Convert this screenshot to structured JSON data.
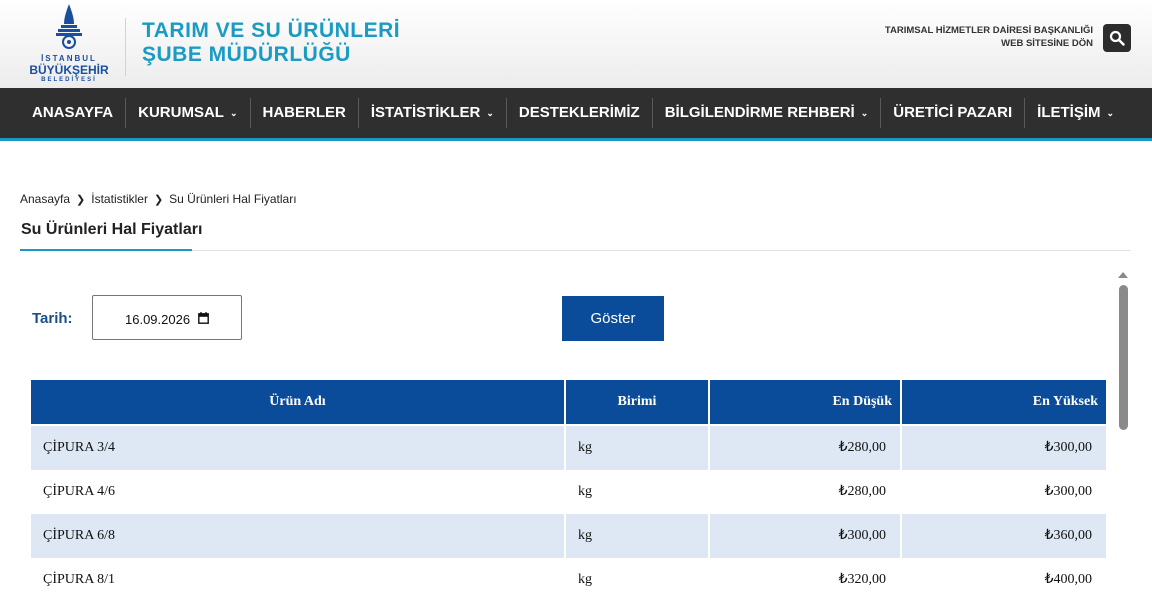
{
  "header": {
    "logo": {
      "line1": "İSTANBUL",
      "line2": "BÜYÜKŞEHİR",
      "line3": "BELEDİYESİ"
    },
    "title_line1": "TARIM VE SU ÜRÜNLERİ",
    "title_line2": "ŞUBE MÜDÜRLÜĞÜ",
    "dept_line1": "TARIMSAL HİZMETLER DAİRESİ BAŞKANLIĞI",
    "dept_line2": "WEB SİTESİNE DÖN",
    "search_icon": "search-icon"
  },
  "nav": {
    "items": [
      {
        "label": "ANASAYFA",
        "has_dropdown": false
      },
      {
        "label": "KURUMSAL",
        "has_dropdown": true
      },
      {
        "label": "HABERLER",
        "has_dropdown": false
      },
      {
        "label": "İSTATİSTİKLER",
        "has_dropdown": true
      },
      {
        "label": "DESTEKLERİMİZ",
        "has_dropdown": false
      },
      {
        "label": "BİLGİLENDİRME REHBERİ",
        "has_dropdown": true
      },
      {
        "label": "ÜRETİCİ PAZARI",
        "has_dropdown": false
      },
      {
        "label": "İLETİŞİM",
        "has_dropdown": true
      }
    ],
    "accent": "#1b97c4"
  },
  "breadcrumb": [
    "Anasayfa",
    "İstatistikler",
    "Su Ürünleri Hal Fiyatları"
  ],
  "page_title": "Su Ürünleri Hal Fiyatları",
  "form": {
    "date_label": "Tarih:",
    "date_value": "16.09.2026",
    "show_button": "Göster"
  },
  "table": {
    "headers": [
      "Ürün Adı",
      "Birimi",
      "En Düşük",
      "En Yüksek"
    ],
    "rows": [
      [
        "ÇİPURA 3/4",
        "kg",
        "₺280,00",
        "₺300,00"
      ],
      [
        "ÇİPURA 4/6",
        "kg",
        "₺280,00",
        "₺300,00"
      ],
      [
        "ÇİPURA 6/8",
        "kg",
        "₺300,00",
        "₺360,00"
      ],
      [
        "ÇİPURA 8/1",
        "kg",
        "₺320,00",
        "₺400,00"
      ]
    ]
  },
  "colors": {
    "primary": "#0b4c9a",
    "row_alt": "#dde8f4",
    "nav_bg": "#2f2f2f",
    "title_blue": "#1a9bc4"
  }
}
